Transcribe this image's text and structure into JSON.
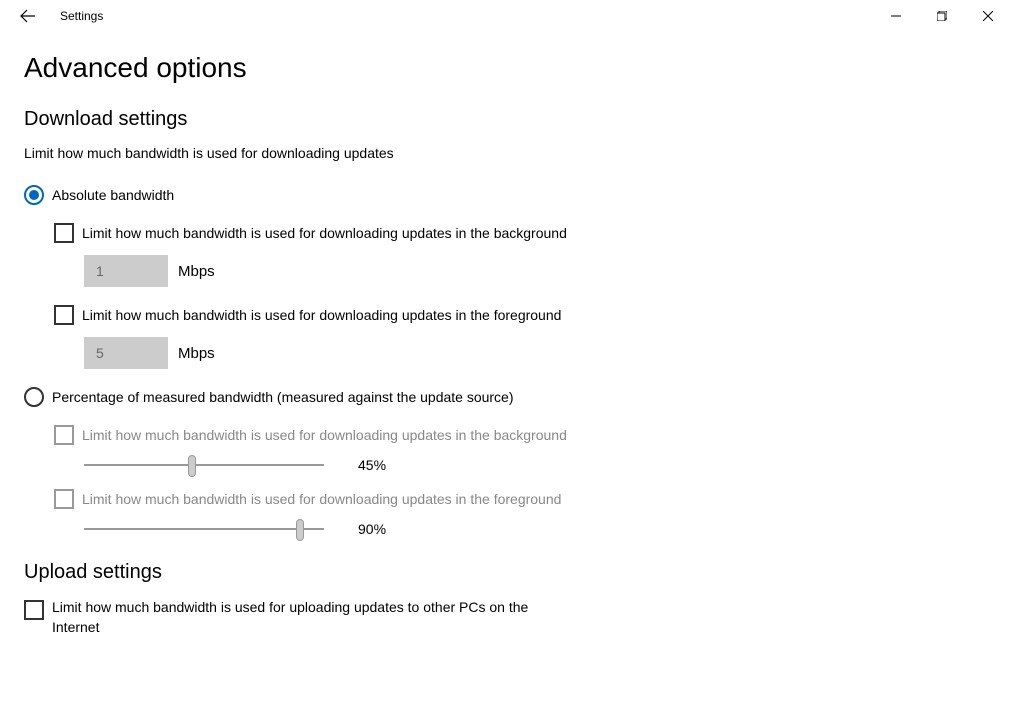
{
  "window": {
    "title": "Settings"
  },
  "page": {
    "heading": "Advanced options"
  },
  "download": {
    "section_title": "Download settings",
    "description": "Limit how much bandwidth is used for downloading updates",
    "absolute": {
      "label": "Absolute bandwidth",
      "bg_check_label": "Limit how much bandwidth is used for downloading updates in the background",
      "bg_value": "1",
      "bg_unit": "Mbps",
      "fg_check_label": "Limit how much bandwidth is used for downloading updates in the foreground",
      "fg_value": "5",
      "fg_unit": "Mbps"
    },
    "percentage": {
      "label": "Percentage of measured bandwidth (measured against the update source)",
      "bg_check_label": "Limit how much bandwidth is used for downloading updates in the background",
      "bg_value": "45%",
      "bg_percent": 45,
      "fg_check_label": "Limit how much bandwidth is used for downloading updates in the foreground",
      "fg_value": "90%",
      "fg_percent": 90
    }
  },
  "upload": {
    "section_title": "Upload settings",
    "check_label": "Limit how much bandwidth is used for uploading updates to other PCs on the Internet"
  }
}
